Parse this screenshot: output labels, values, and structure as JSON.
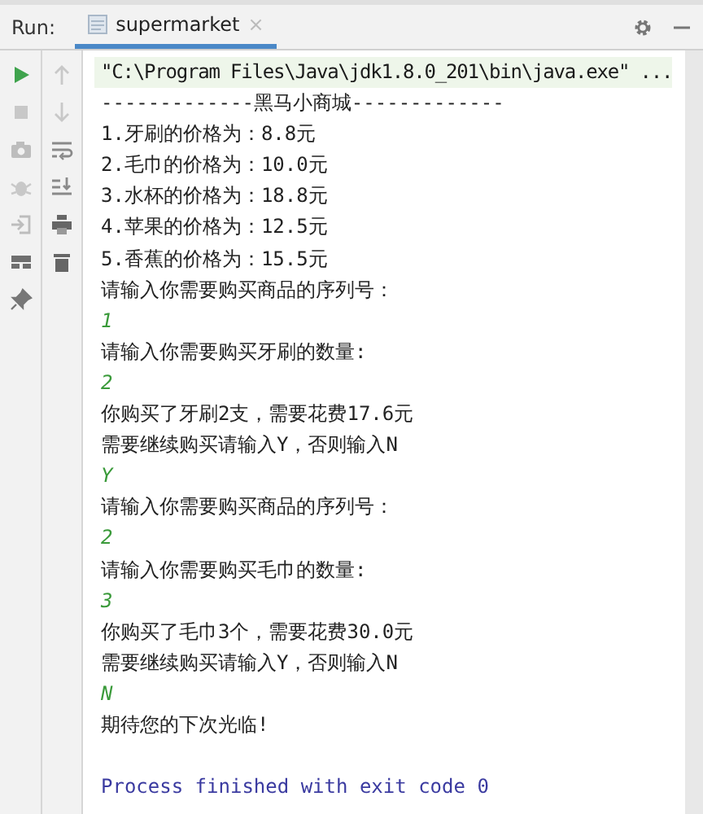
{
  "run_panel": {
    "label": "Run:",
    "tabs": [
      {
        "label": "supermarket",
        "selected": true,
        "close": "×"
      }
    ]
  },
  "console": {
    "lines": [
      {
        "kind": "command",
        "text": "\"C:\\Program Files\\Java\\jdk1.8.0_201\\bin\\java.exe\" ..."
      },
      {
        "kind": "output",
        "text": "-------------黑马小商城-------------"
      },
      {
        "kind": "output",
        "text": "1.牙刷的价格为：8.8元"
      },
      {
        "kind": "output",
        "text": "2.毛巾的价格为：10.0元"
      },
      {
        "kind": "output",
        "text": "3.水杯的价格为：18.8元"
      },
      {
        "kind": "output",
        "text": "4.苹果的价格为：12.5元"
      },
      {
        "kind": "output",
        "text": "5.香蕉的价格为：15.5元"
      },
      {
        "kind": "output",
        "text": "请输入你需要购买商品的序列号："
      },
      {
        "kind": "input",
        "text": "1"
      },
      {
        "kind": "output",
        "text": "请输入你需要购买牙刷的数量:"
      },
      {
        "kind": "input",
        "text": "2"
      },
      {
        "kind": "output",
        "text": "你购买了牙刷2支，需要花费17.6元"
      },
      {
        "kind": "output",
        "text": "需要继续购买请输入Y，否则输入N"
      },
      {
        "kind": "input",
        "text": "Y"
      },
      {
        "kind": "output",
        "text": "请输入你需要购买商品的序列号："
      },
      {
        "kind": "input",
        "text": "2"
      },
      {
        "kind": "output",
        "text": "请输入你需要购买毛巾的数量:"
      },
      {
        "kind": "input",
        "text": "3"
      },
      {
        "kind": "output",
        "text": "你购买了毛巾3个，需要花费30.0元"
      },
      {
        "kind": "output",
        "text": "需要继续购买请输入Y，否则输入N"
      },
      {
        "kind": "input",
        "text": "N"
      },
      {
        "kind": "output",
        "text": "期待您的下次光临!"
      },
      {
        "kind": "exit",
        "text": "Process finished with exit code 0"
      }
    ]
  }
}
